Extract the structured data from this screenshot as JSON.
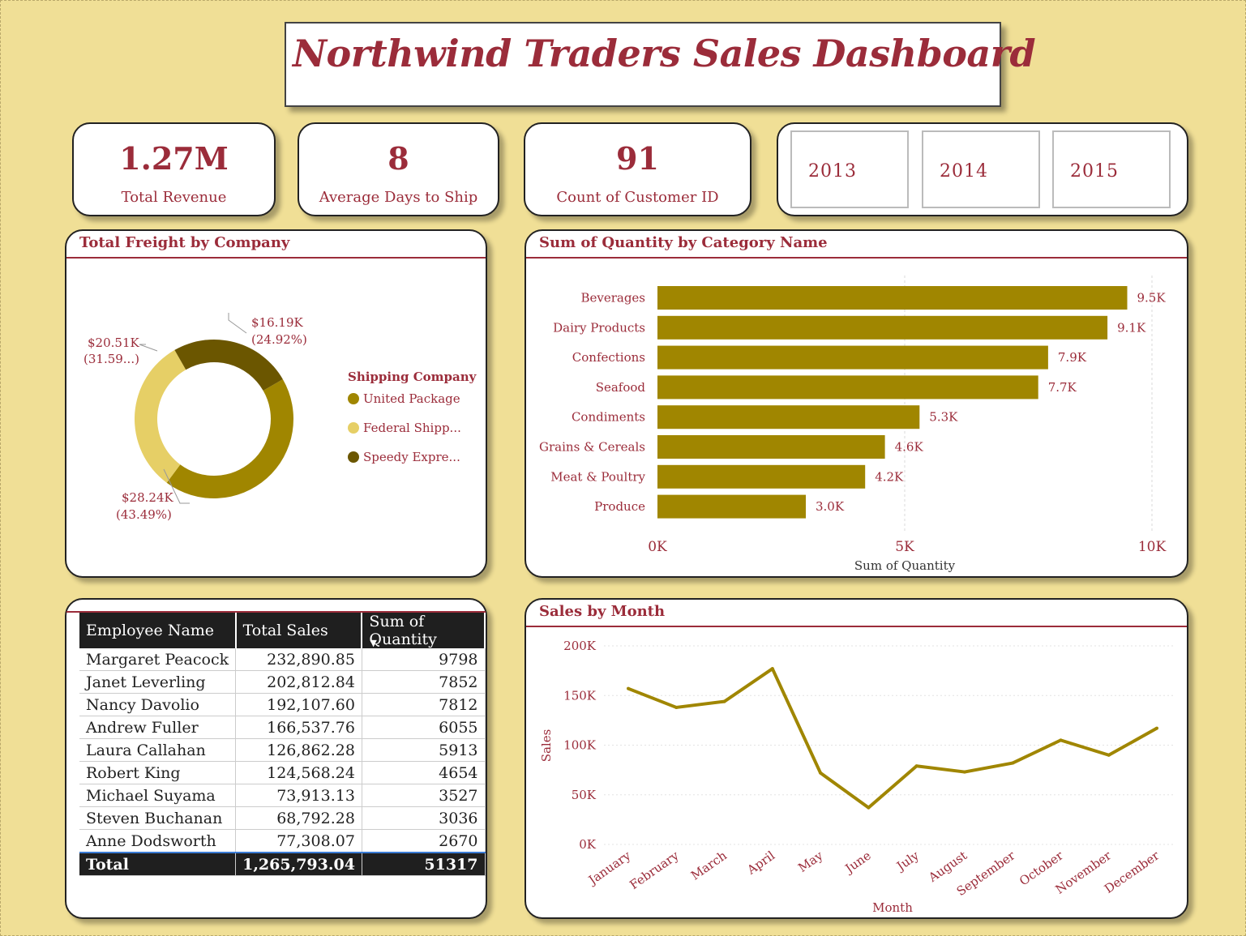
{
  "header": {
    "title": "Northwind Traders Sales Dashboard"
  },
  "kpis": [
    {
      "value": "1.27M",
      "label": "Total Revenue"
    },
    {
      "value": "8",
      "label": "Average Days to Ship"
    },
    {
      "value": "91",
      "label": "Count of Customer ID"
    }
  ],
  "year_slicer": {
    "options": [
      "2013",
      "2014",
      "2015"
    ]
  },
  "freight": {
    "title": "Total Freight by Company",
    "legend_title": "Shipping Company",
    "legend_items": [
      "United Package",
      "Federal Shipp...",
      "Speedy Expre..."
    ],
    "labels": [
      {
        "value": "$16.19K",
        "pct": "(24.92%)"
      },
      {
        "value": "$20.51K",
        "pct": "(31.59...)"
      },
      {
        "value": "$28.24K",
        "pct": "(43.49%)"
      }
    ]
  },
  "category": {
    "title": "Sum of Quantity by Category Name"
  },
  "employees": {
    "headers": [
      "Employee Name",
      "Total Sales",
      "Sum of Quantity"
    ],
    "rows": [
      [
        "Margaret Peacock",
        "232,890.85",
        "9798"
      ],
      [
        "Janet Leverling",
        "202,812.84",
        "7852"
      ],
      [
        "Nancy Davolio",
        "192,107.60",
        "7812"
      ],
      [
        "Andrew Fuller",
        "166,537.76",
        "6055"
      ],
      [
        "Laura Callahan",
        "126,862.28",
        "5913"
      ],
      [
        "Robert King",
        "124,568.24",
        "4654"
      ],
      [
        "Michael Suyama",
        "73,913.13",
        "3527"
      ],
      [
        "Steven Buchanan",
        "68,792.28",
        "3036"
      ],
      [
        "Anne Dodsworth",
        "77,308.07",
        "2670"
      ]
    ],
    "total": [
      "Total",
      "1,265,793.04",
      "51317"
    ]
  },
  "monthly": {
    "title": "Sales by Month"
  },
  "colors": {
    "accent": "#9b2c3a",
    "bar": "#a08600",
    "united_package": "#a08600",
    "federal_shipping": "#e6cf66",
    "speedy_express": "#6b5600",
    "background": "#f0df96"
  },
  "chart_data": [
    {
      "type": "pie",
      "title": "Total Freight by Company",
      "legend_title": "Shipping Company",
      "categories": [
        "United Package",
        "Federal Shipping",
        "Speedy Express"
      ],
      "values": [
        28.24,
        20.51,
        16.19
      ],
      "unit": "$K",
      "percentages": [
        43.49,
        31.59,
        24.92
      ],
      "legend": "right"
    },
    {
      "type": "bar",
      "orientation": "horizontal",
      "title": "Sum of Quantity by Category Name",
      "xlabel": "Sum of Quantity",
      "ylabel": "",
      "categories": [
        "Beverages",
        "Dairy Products",
        "Confections",
        "Seafood",
        "Condiments",
        "Grains & Cereals",
        "Meat & Poultry",
        "Produce"
      ],
      "values": [
        9500,
        9100,
        7900,
        7700,
        5300,
        4600,
        4200,
        3000
      ],
      "data_labels": [
        "9.5K",
        "9.1K",
        "7.9K",
        "7.7K",
        "5.3K",
        "4.6K",
        "4.2K",
        "3.0K"
      ],
      "xlim": [
        0,
        10000
      ],
      "xticks": [
        "0K",
        "5K",
        "10K"
      ],
      "grid": true
    },
    {
      "type": "line",
      "title": "Sales by Month",
      "xlabel": "Month",
      "ylabel": "Sales",
      "categories": [
        "January",
        "February",
        "March",
        "April",
        "May",
        "June",
        "July",
        "August",
        "September",
        "October",
        "November",
        "December"
      ],
      "values": [
        157000,
        138000,
        144000,
        177000,
        72000,
        37000,
        79000,
        73000,
        82000,
        105000,
        90000,
        117000
      ],
      "ylim": [
        0,
        200000
      ],
      "yticks": [
        "0K",
        "50K",
        "100K",
        "150K",
        "200K"
      ],
      "grid": true
    }
  ]
}
